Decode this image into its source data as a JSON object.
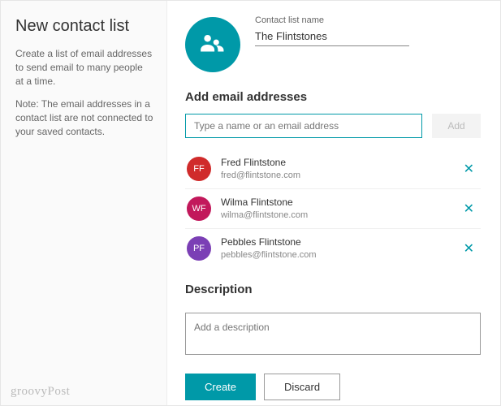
{
  "sidebar": {
    "title": "New contact list",
    "p1": "Create a list of email addresses to send email to many people at a time.",
    "p2": "Note: The email addresses in a contact list are not connected to your saved contacts."
  },
  "header": {
    "label": "Contact list name",
    "value": "The Flintstones"
  },
  "add_section": {
    "title": "Add email addresses",
    "placeholder": "Type a name or an email address",
    "add_label": "Add"
  },
  "contacts": [
    {
      "initials": "FF",
      "name": "Fred Flintstone",
      "email": "fred@flintstone.com",
      "color": "#d02b2b"
    },
    {
      "initials": "WF",
      "name": "Wilma Flintstone",
      "email": "wilma@flintstone.com",
      "color": "#c2185b"
    },
    {
      "initials": "PF",
      "name": "Pebbles Flintstone",
      "email": "pebbles@flintstone.com",
      "color": "#7b3fb5"
    }
  ],
  "description": {
    "title": "Description",
    "placeholder": "Add a description"
  },
  "actions": {
    "create": "Create",
    "discard": "Discard"
  },
  "watermark": "groovyPost"
}
